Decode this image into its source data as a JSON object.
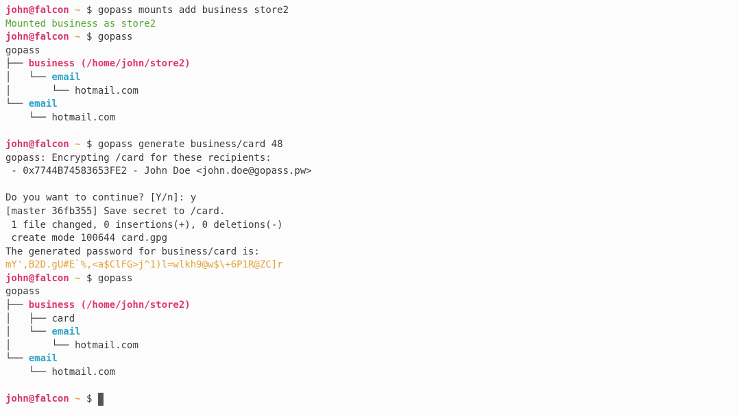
{
  "colors": {
    "background": "#fcfcfc",
    "text": "#3a3a3a",
    "user": "#d6336c",
    "tilde": "#e0a63a",
    "dollar": "#3a3a3a",
    "success": "#56a832",
    "store": "#e0366a",
    "folder": "#2fa4c8",
    "password": "#e6a23c"
  },
  "prompt": {
    "user": "john",
    "at": "@",
    "host": "falcon",
    "tilde": " ~ ",
    "dollar": "$ "
  },
  "lines": [
    {
      "type": "prompt",
      "cmd": "gopass mounts add business store2"
    },
    {
      "type": "text",
      "text": "Mounted business as store2",
      "color": "success"
    },
    {
      "type": "prompt",
      "cmd": "gopass"
    },
    {
      "type": "text",
      "text": "gopass"
    },
    {
      "type": "tree",
      "prefix": "├── ",
      "text": "business (/home/john/store2)",
      "color": "store",
      "bold": true
    },
    {
      "type": "tree",
      "prefix": "│   └── ",
      "text": "email",
      "color": "folder",
      "bold": true
    },
    {
      "type": "tree",
      "prefix": "│       └── ",
      "text": "hotmail.com"
    },
    {
      "type": "tree",
      "prefix": "└── ",
      "text": "email",
      "color": "folder",
      "bold": true
    },
    {
      "type": "tree",
      "prefix": "    └── ",
      "text": "hotmail.com"
    },
    {
      "type": "blank"
    },
    {
      "type": "prompt",
      "cmd": "gopass generate business/card 48"
    },
    {
      "type": "text",
      "text": "gopass: Encrypting /card for these recipients:"
    },
    {
      "type": "text",
      "text": " - 0x7744B74583653FE2 - John Doe <john.doe@gopass.pw>"
    },
    {
      "type": "blank"
    },
    {
      "type": "text",
      "text": "Do you want to continue? [Y/n]: y"
    },
    {
      "type": "text",
      "text": "[master 36fb355] Save secret to /card."
    },
    {
      "type": "text",
      "text": " 1 file changed, 0 insertions(+), 0 deletions(-)"
    },
    {
      "type": "text",
      "text": " create mode 100644 card.gpg"
    },
    {
      "type": "text",
      "text": "The generated password for business/card is:"
    },
    {
      "type": "text",
      "text": "mY',B2D.gU#E`%,<a$ClFG>j^1)l=wlkh9@w$\\+6P1R@ZC]r",
      "color": "password"
    },
    {
      "type": "prompt",
      "cmd": "gopass"
    },
    {
      "type": "text",
      "text": "gopass"
    },
    {
      "type": "tree",
      "prefix": "├── ",
      "text": "business (/home/john/store2)",
      "color": "store",
      "bold": true
    },
    {
      "type": "tree",
      "prefix": "│   ├── ",
      "text": "card"
    },
    {
      "type": "tree",
      "prefix": "│   └── ",
      "text": "email",
      "color": "folder",
      "bold": true
    },
    {
      "type": "tree",
      "prefix": "│       └── ",
      "text": "hotmail.com"
    },
    {
      "type": "tree",
      "prefix": "└── ",
      "text": "email",
      "color": "folder",
      "bold": true
    },
    {
      "type": "tree",
      "prefix": "    └── ",
      "text": "hotmail.com"
    },
    {
      "type": "blank"
    },
    {
      "type": "prompt",
      "cmd": "",
      "cursor": true
    }
  ]
}
